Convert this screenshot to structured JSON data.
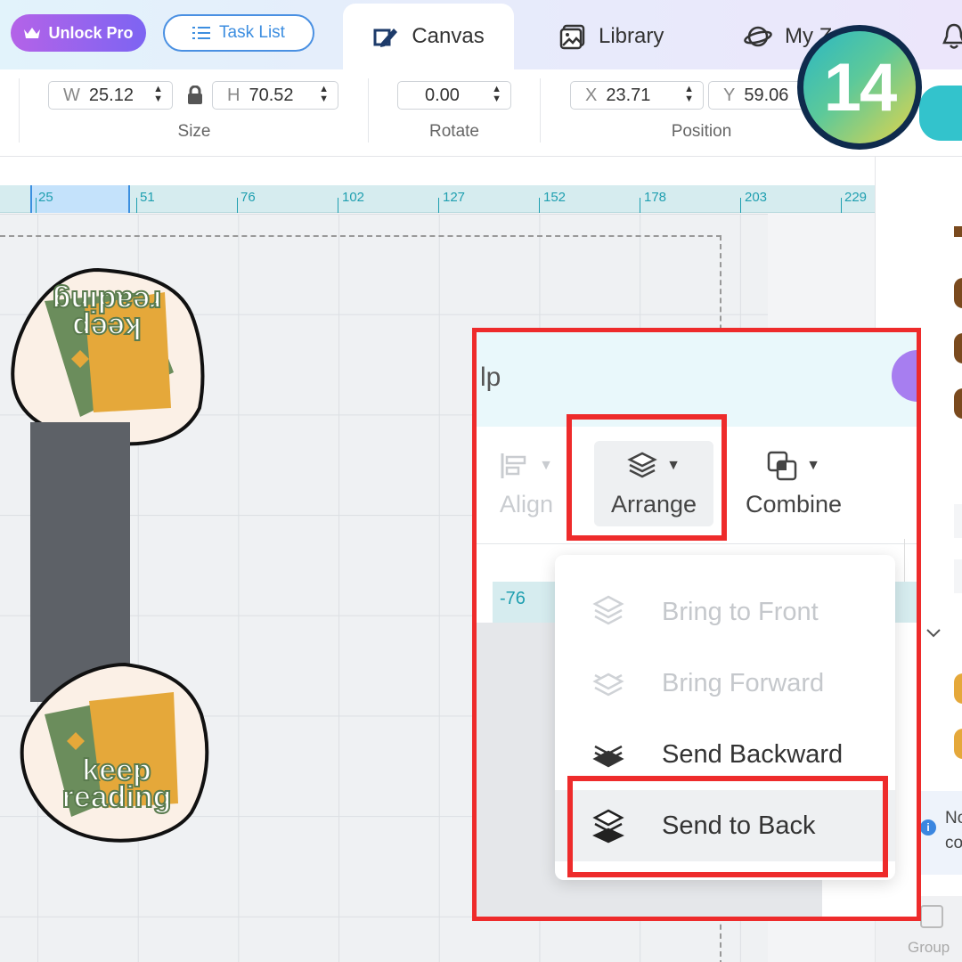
{
  "topbar": {
    "unlock_label": "Unlock Pro",
    "tasklist_label": "Task List",
    "tabs": [
      {
        "label": "Canvas",
        "icon": "canvas-pen-icon"
      },
      {
        "label": "Library",
        "icon": "image-icon"
      },
      {
        "label": "My Z",
        "icon": "planet-icon"
      }
    ]
  },
  "step_badge": "14",
  "properties": {
    "size": {
      "label": "Size",
      "w_prefix": "W",
      "w": "25.12",
      "h_prefix": "H",
      "h": "70.52"
    },
    "rotate": {
      "label": "Rotate",
      "value": "0.00"
    },
    "position": {
      "label": "Position",
      "x_prefix": "X",
      "x": "23.71",
      "y_prefix": "Y",
      "y": "59.06"
    }
  },
  "ruler": [
    "25",
    "51",
    "76",
    "102",
    "127",
    "152",
    "178",
    "203",
    "229"
  ],
  "zoom_callout": {
    "header_text": "lp",
    "tools": [
      {
        "label": "Align",
        "enabled": false
      },
      {
        "label": "Arrange",
        "enabled": true
      },
      {
        "label": "Combine",
        "enabled": true
      }
    ],
    "ruler_value": "-76"
  },
  "arrange_menu": [
    {
      "label": "Bring to Front",
      "enabled": false
    },
    {
      "label": "Bring Forward",
      "enabled": false
    },
    {
      "label": "Send Backward",
      "enabled": true
    },
    {
      "label": "Send to Back",
      "enabled": true
    }
  ],
  "stickers": [
    {
      "line1": "keep",
      "line2": "reading"
    },
    {
      "line1": "keep",
      "line2": "reading"
    }
  ],
  "right_panel": {
    "info_text_1": "No",
    "info_text_2": "co",
    "group_label": "Group"
  },
  "colors": {
    "highlight": "#ee2b2b",
    "ruler_text": "#1f9fb0",
    "accent_blue": "#3b8fe0"
  }
}
